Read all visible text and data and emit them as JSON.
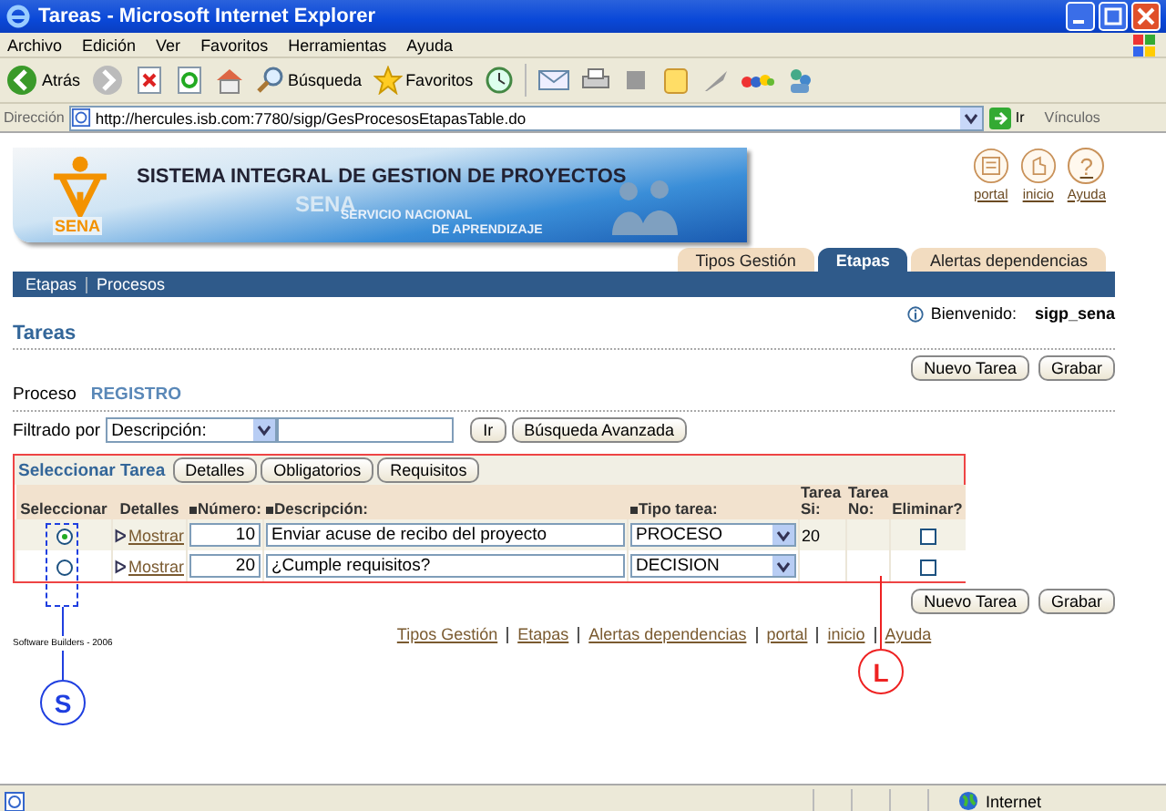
{
  "window": {
    "title": "Tareas - Microsoft Internet Explorer"
  },
  "menu_bar": [
    "Archivo",
    "Edición",
    "Ver",
    "Favoritos",
    "Herramientas",
    "Ayuda"
  ],
  "toolbar": {
    "back": "Atrás",
    "search": "Búsqueda",
    "favorites": "Favoritos"
  },
  "address_bar": {
    "label": "Dirección",
    "url": "http://hercules.isb.com:7780/sigp/GesProcesosEtapasTable.do",
    "go": "Ir",
    "links": "Vínculos"
  },
  "banner": {
    "logo_text": "SENA",
    "title": "SISTEMA INTEGRAL DE GESTION DE PROYECTOS",
    "watermark": "SENA",
    "subtitle_1": "SERVICIO NACIONAL",
    "subtitle_2": "DE APRENDIZAJE"
  },
  "header_links": [
    {
      "kind": "portal",
      "label": "portal"
    },
    {
      "kind": "home",
      "label": "inicio"
    },
    {
      "kind": "help",
      "label": "Ayuda",
      "glyph": "?"
    }
  ],
  "tabs": [
    {
      "label": "Tipos Gestión",
      "selected": false
    },
    {
      "label": "Etapas",
      "selected": true
    },
    {
      "label": "Alertas dependencias",
      "selected": false
    }
  ],
  "subnav": [
    "Etapas",
    "Procesos"
  ],
  "welcome": {
    "label": "Bienvenido:",
    "user": "sigp_sena"
  },
  "page_title": "Tareas",
  "top_actions": [
    "Nuevo Tarea",
    "Grabar"
  ],
  "process": {
    "label": "Proceso",
    "value": "REGISTRO"
  },
  "filter": {
    "label": "Filtrado por",
    "field": "Descripción:",
    "go": "Ir",
    "advanced": "Búsqueda Avanzada"
  },
  "table": {
    "title": "Seleccionar Tarea",
    "buttons": [
      "Detalles",
      "Obligatorios",
      "Requisitos"
    ],
    "columns": [
      {
        "label": "Seleccionar",
        "required": false
      },
      {
        "label": "Detalles",
        "required": false
      },
      {
        "label": "Número:",
        "required": true
      },
      {
        "label": "Descripción:",
        "required": true
      },
      {
        "label": "Tipo tarea:",
        "required": true
      },
      {
        "label": "Tarea Si:",
        "required": false
      },
      {
        "label": "Tarea No:",
        "required": false
      },
      {
        "label": "Eliminar?",
        "required": false
      }
    ],
    "rows": [
      {
        "selected": true,
        "details": "Mostrar",
        "number": "10",
        "description": "Enviar acuse de recibo del proyecto",
        "type": "PROCESO",
        "yes": "20",
        "delete": false
      },
      {
        "selected": false,
        "details": "Mostrar",
        "number": "20",
        "description": "¿Cumple requisitos?",
        "type": "DECISION",
        "delete": false
      }
    ]
  },
  "bottom_actions": [
    "Nuevo Tarea",
    "Grabar"
  ],
  "copyright": "Software Builders - 2006",
  "footer_links": [
    "Tipos Gestión",
    "Etapas",
    "Alertas dependencias",
    "portal",
    "inicio",
    "Ayuda"
  ],
  "annotations": [
    {
      "label": "S",
      "color": "#1f3fe0"
    },
    {
      "label": "L",
      "color": "#ee2222"
    }
  ],
  "status_bar": {
    "zone": "Internet"
  }
}
